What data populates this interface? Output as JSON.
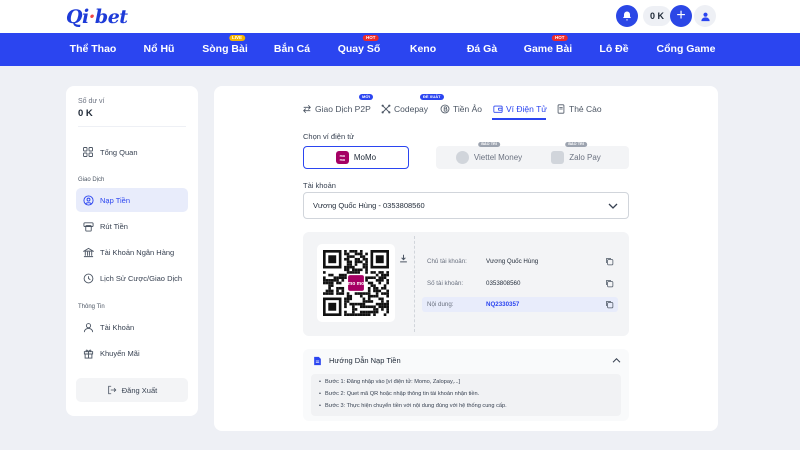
{
  "brand": {
    "logo_text": "Qibet",
    "accent": "#2b45f0"
  },
  "header": {
    "balance": "0 K",
    "icons": [
      "bell-icon",
      "plus-icon",
      "user-icon"
    ]
  },
  "nav": {
    "items": [
      {
        "label": "Thể Thao"
      },
      {
        "label": "Nổ Hũ"
      },
      {
        "label": "Sòng Bài",
        "badge": "LIVE"
      },
      {
        "label": "Bắn Cá"
      },
      {
        "label": "Quay Số",
        "badge": "HOT"
      },
      {
        "label": "Keno"
      },
      {
        "label": "Đá Gà"
      },
      {
        "label": "Game Bài",
        "badge": "HOT"
      },
      {
        "label": "Lô Đề"
      },
      {
        "label": "Cổng Game"
      }
    ]
  },
  "sidebar": {
    "balance_label": "Số dư ví",
    "balance_value": "0 K",
    "overview": "Tổng Quan",
    "section_transactions": "Giao Dịch",
    "deposit": "Nạp Tiền",
    "withdraw": "Rút Tiền",
    "bank_account": "Tài Khoản Ngân Hàng",
    "history": "Lịch Sử Cược/Giao Dịch",
    "section_info": "Thông Tin",
    "account": "Tài Khoản",
    "promotions": "Khuyến Mãi",
    "logout": "Đăng Xuất"
  },
  "tabs": [
    {
      "label": "Giao Dịch P2P",
      "badge": "MỚI"
    },
    {
      "label": "Codepay",
      "badge": "ĐỀ XUẤT"
    },
    {
      "label": "Tiền Ảo"
    },
    {
      "label": "Ví Điện Tử",
      "active": true
    },
    {
      "label": "Thẻ Cào"
    }
  ],
  "wallet": {
    "label": "Chọn ví điện tử",
    "options": [
      {
        "name": "MoMo",
        "selected": true
      },
      {
        "name": "Viettel Money",
        "badge": "BẢO TRÌ"
      },
      {
        "name": "Zalo Pay",
        "badge": "BẢO TRÌ"
      }
    ]
  },
  "account": {
    "label": "Tài khoản",
    "selected": "Vương Quốc Hùng - 0353808560"
  },
  "transfer_info": {
    "holder_label": "Chủ tài khoản:",
    "holder_value": "Vương Quốc Hùng",
    "number_label": "Số tài khoản:",
    "number_value": "0353808560",
    "content_label": "Nội dung:",
    "content_value": "NQ2330357",
    "qr_center_text": "mo mo"
  },
  "guide": {
    "title": "Hướng Dẫn Nạp Tiền",
    "steps": [
      "Bước 1: Đăng nhập vào [ví điện tử: Momo, Zalopay,...]",
      "Bước 2: Quet mã QR hoặc nhập thông tin tài khoản nhận tiền.",
      "Bước 3: Thực hiện chuyển tiền với nội dung đúng với hệ thống cung cấp."
    ]
  }
}
